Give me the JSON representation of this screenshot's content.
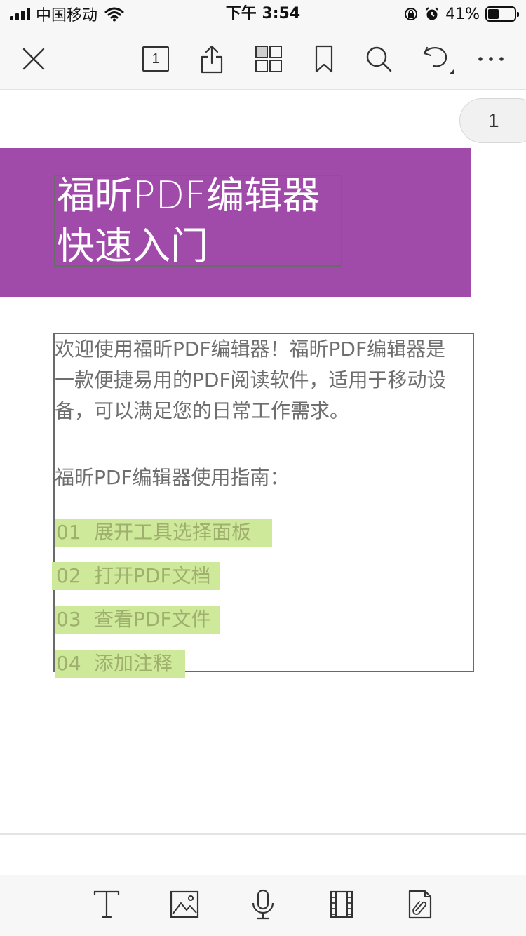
{
  "status_bar": {
    "carrier": "中国移动",
    "time": "下午 3:54",
    "battery_percent": "41%",
    "battery_level": 0.41,
    "icons": [
      "signal-icon",
      "wifi-icon",
      "orientation-lock-icon",
      "alarm-icon",
      "battery-icon"
    ]
  },
  "toolbar": {
    "page_count_label": "1",
    "icons": [
      "close-icon",
      "page-count-icon",
      "share-icon",
      "thumbnails-icon",
      "bookmark-icon",
      "search-icon",
      "undo-icon",
      "more-icon"
    ]
  },
  "document": {
    "page_indicator": "1",
    "title_line1": "福昕PDF编辑器",
    "title_line2": "快速入门",
    "intro_line1": "欢迎使用福昕PDF编辑器！福昕PDF编辑器是",
    "intro_line2": "一款便捷易用的PDF阅读软件，适用于移动设",
    "intro_line3": "备，可以满足您的日常工作需求。",
    "guide_heading": "福昕PDF编辑器使用指南：",
    "items": [
      {
        "num": "01",
        "text": "展开工具选择面板"
      },
      {
        "num": "02",
        "text": "打开PDF文档"
      },
      {
        "num": "03",
        "text": "查看PDF文件"
      },
      {
        "num": "04",
        "text": "添加注释"
      }
    ],
    "colors": {
      "banner": "#a04aaa",
      "highlight": "#cfe99a",
      "highlight_text": "#9fb06e",
      "body_text": "#6e6e6e"
    }
  },
  "bottom_toolbar": {
    "icons": [
      "text-tool-icon",
      "image-tool-icon",
      "audio-tool-icon",
      "video-tool-icon",
      "attachment-tool-icon"
    ]
  }
}
